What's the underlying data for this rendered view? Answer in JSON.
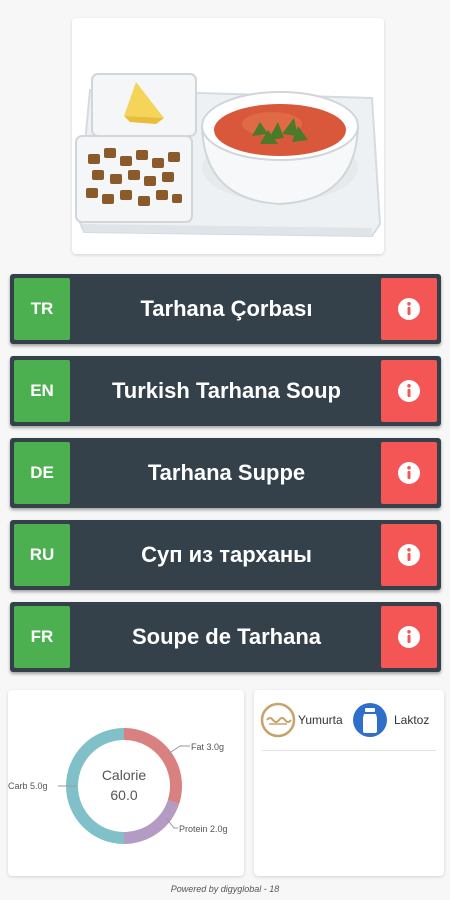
{
  "dish_photo": {
    "icon": "soup-plate-image"
  },
  "languages": [
    {
      "code": "TR",
      "name": "Tarhana Çorbası"
    },
    {
      "code": "EN",
      "name": "Turkish Tarhana Soup"
    },
    {
      "code": "DE",
      "name": "Tarhana Suppe"
    },
    {
      "code": "RU",
      "name": "Суп из тарханы"
    },
    {
      "code": "FR",
      "name": "Soupe de Tarhana"
    }
  ],
  "nutrition": {
    "center_label": "Calorie",
    "center_value": "60.0",
    "fat_label": "Fat 3.0g",
    "carb_label": "Carb 5.0g",
    "protein_label": "Protein 2.0g"
  },
  "chart_data": {
    "type": "pie",
    "title": "",
    "slices": [
      {
        "label": "Fat",
        "value": 3.0,
        "color": "#d98080"
      },
      {
        "label": "Protein",
        "value": 2.0,
        "color": "#b39bc4"
      },
      {
        "label": "Carb",
        "value": 5.0,
        "color": "#7fc0c9"
      }
    ],
    "center_text": [
      "Calorie",
      "60.0"
    ]
  },
  "allergens": [
    {
      "name": "Yumurta",
      "icon": "egg-icon",
      "color": "#c9a26b"
    },
    {
      "name": "Laktoz",
      "icon": "milk-bottle-icon",
      "color": "#2f6fc9"
    }
  ],
  "footer": {
    "text": "Powered by digyglobal - 18"
  },
  "colors": {
    "row_background": "#34404a",
    "code_background": "#4caf50",
    "info_background": "#f45555"
  }
}
